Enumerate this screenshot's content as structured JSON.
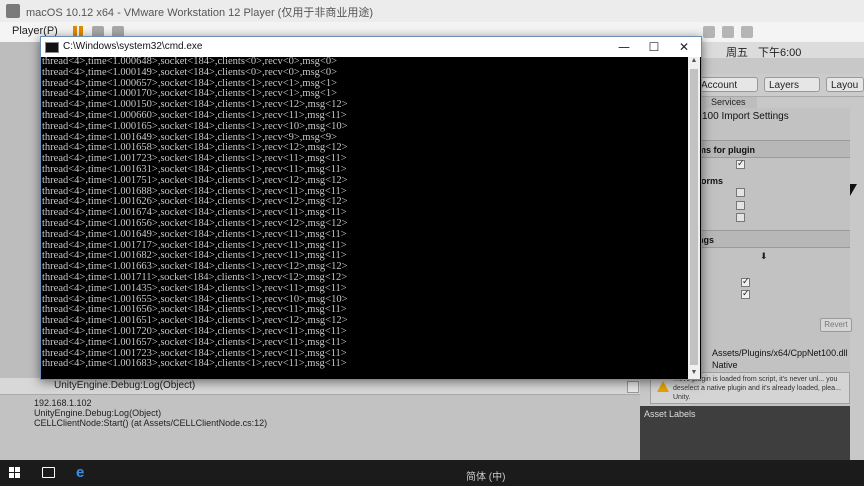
{
  "vmware": {
    "title": "macOS 10.12 x64 - VMware Workstation 12 Player (仅用于非商业用途)",
    "player_menu": "Player(P)"
  },
  "mac_menubar": {
    "day": "周五",
    "clock": "下午6:00"
  },
  "unity": {
    "toolbar": {
      "account": "Account",
      "layers": "Layers",
      "layout": "Layou"
    },
    "services_tab": "Services",
    "import_title": "100 Import Settings",
    "section_platforms_for_plugin": "ms for plugin",
    "section_platform_settings": "forms",
    "section_settings": "ngs",
    "revert_label": "Revert",
    "dll_path": "Assets/Plugins/x64/CppNet100.dll",
    "native_label": "Native",
    "warning_text": "...ove plugin is loaded from script, it's never unl... you deselect a native plugin and it's already loaded, plea... Unity.",
    "asset_labels": "Asset Labels",
    "console": {
      "selected_message": "UnityEngine.Debug:Log(Object)",
      "detail_lines": [
        "192.168.1.102",
        "UnityEngine.Debug:Log(Object)",
        "CELLClientNode:Start() (at Assets/CELLClientNode.cs:12)"
      ]
    }
  },
  "cmd": {
    "title": "C:\\Windows\\system32\\cmd.exe",
    "minimize": "—",
    "maximize": "☐",
    "close": "✕",
    "lines": [
      "thread<4>,time<1.000648>,socket<184>,clients<0>,recv<0>,msg<0>",
      "thread<4>,time<1.000149>,socket<184>,clients<0>,recv<0>,msg<0>",
      "thread<4>,time<1.000657>,socket<184>,clients<1>,recv<1>,msg<1>",
      "thread<4>,time<1.000170>,socket<184>,clients<1>,recv<1>,msg<1>",
      "thread<4>,time<1.000150>,socket<184>,clients<1>,recv<12>,msg<12>",
      "thread<4>,time<1.000660>,socket<184>,clients<1>,recv<11>,msg<11>",
      "thread<4>,time<1.000165>,socket<184>,clients<1>,recv<10>,msg<10>",
      "thread<4>,time<1.001649>,socket<184>,clients<1>,recv<9>,msg<9>",
      "thread<4>,time<1.001658>,socket<184>,clients<1>,recv<12>,msg<12>",
      "thread<4>,time<1.001723>,socket<184>,clients<1>,recv<11>,msg<11>",
      "thread<4>,time<1.001631>,socket<184>,clients<1>,recv<11>,msg<11>",
      "thread<4>,time<1.001751>,socket<184>,clients<1>,recv<12>,msg<12>",
      "thread<4>,time<1.001688>,socket<184>,clients<1>,recv<11>,msg<11>",
      "thread<4>,time<1.001626>,socket<184>,clients<1>,recv<12>,msg<12>",
      "thread<4>,time<1.001674>,socket<184>,clients<1>,recv<11>,msg<11>",
      "thread<4>,time<1.001656>,socket<184>,clients<1>,recv<12>,msg<12>",
      "thread<4>,time<1.001649>,socket<184>,clients<1>,recv<11>,msg<11>",
      "thread<4>,time<1.001717>,socket<184>,clients<1>,recv<11>,msg<11>",
      "thread<4>,time<1.001682>,socket<184>,clients<1>,recv<11>,msg<11>",
      "thread<4>,time<1.001663>,socket<184>,clients<1>,recv<12>,msg<12>",
      "thread<4>,time<1.001711>,socket<184>,clients<1>,recv<12>,msg<12>",
      "thread<4>,time<1.001435>,socket<184>,clients<1>,recv<11>,msg<11>",
      "thread<4>,time<1.001655>,socket<184>,clients<1>,recv<10>,msg<10>",
      "thread<4>,time<1.001656>,socket<184>,clients<1>,recv<11>,msg<11>",
      "thread<4>,time<1.001651>,socket<184>,clients<1>,recv<12>,msg<12>",
      "thread<4>,time<1.001720>,socket<184>,clients<1>,recv<11>,msg<11>",
      "thread<4>,time<1.001657>,socket<184>,clients<1>,recv<11>,msg<11>",
      "thread<4>,time<1.001723>,socket<184>,clients<1>,recv<11>,msg<11>",
      "thread<4>,time<1.001683>,socket<184>,clients<1>,recv<11>,msg<11>"
    ]
  },
  "taskbar": {
    "tray_text": "简体 (中)"
  }
}
